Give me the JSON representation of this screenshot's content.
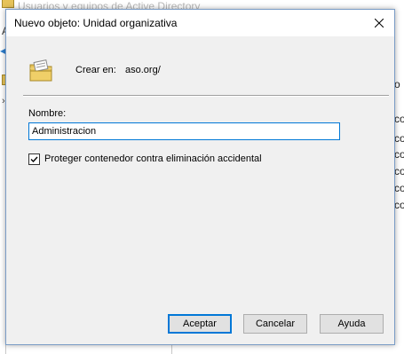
{
  "background_window": {
    "title": "Usuarios y equipos de Active Directory",
    "menu_letter": "A",
    "right_column": [
      "o",
      "co",
      "co",
      "co",
      "co",
      "co",
      "co"
    ]
  },
  "dialog": {
    "title": "Nuevo objeto: Unidad organizativa",
    "create_in_label": "Crear en:",
    "create_in_value": "aso.org/",
    "name_label": "Nombre:",
    "name_value": "Administracion",
    "protect_checkbox": {
      "label": "Proteger contenedor contra eliminación accidental",
      "checked": true
    },
    "buttons": {
      "accept": "Aceptar",
      "cancel": "Cancelar",
      "help": "Ayuda"
    }
  },
  "colors": {
    "accent": "#0078d7",
    "dialog_bg": "#f0f0f0",
    "folder_yellow": "#e6c35a"
  },
  "icons": {
    "close": "close-icon",
    "ou": "organizational-unit-icon",
    "check": "checkmark-icon"
  }
}
